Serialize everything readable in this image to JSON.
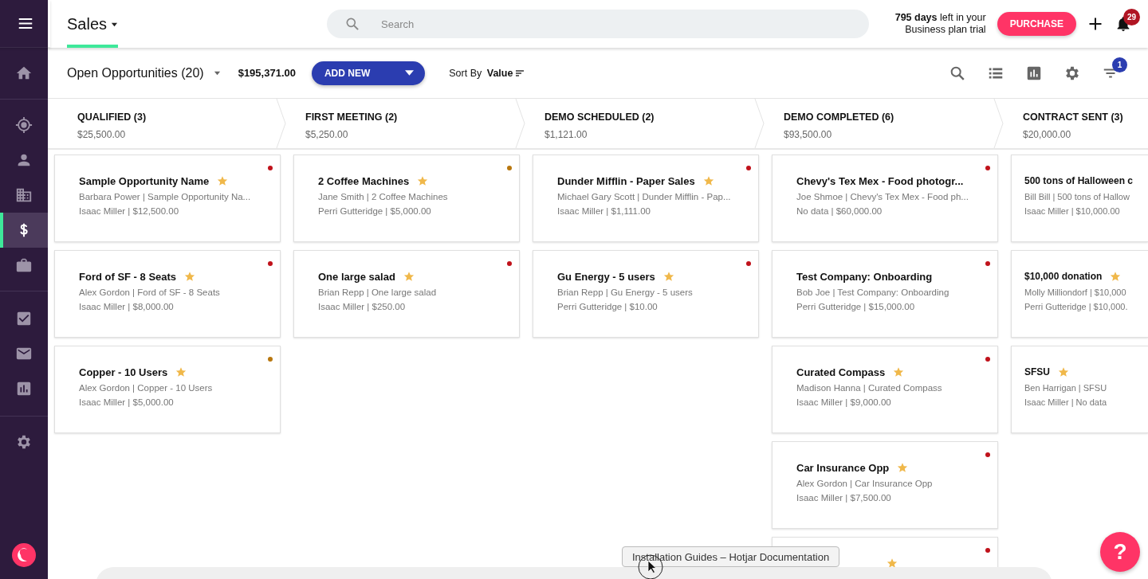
{
  "sidebar": {
    "items": [
      {
        "selected": false
      },
      {
        "selected": false
      },
      {
        "selected": false
      },
      {
        "selected": false
      },
      {
        "selected": true
      },
      {
        "selected": false
      },
      {
        "selected": false
      },
      {
        "selected": false
      },
      {
        "selected": false
      },
      {
        "selected": false
      }
    ]
  },
  "header": {
    "title": "Sales",
    "search": {
      "placeholder": "Search"
    },
    "trial": "**795 days** left in your Business plan trial",
    "purchase": "PURCHASE",
    "notifications": "29"
  },
  "toolbar": {
    "view": "Open Opportunities (20)",
    "total": "$195,371.00",
    "add": "ADD NEW",
    "sort_label": "Sort By",
    "sort_value": "Value",
    "filter_count": "1"
  },
  "stages": [
    {
      "name": "QUALIFIED (3)",
      "amount": "$25,500.00",
      "cards": [
        {
          "title": "Sample Opportunity Name",
          "starred": true,
          "line1": "Barbara Power | Sample Opportunity Na...",
          "line2": "Isaac Miller | $12,500.00",
          "color": "#c0121b"
        },
        {
          "title": "Ford of SF - 8 Seats",
          "starred": true,
          "line1": "Alex Gordon | Ford of SF - 8 Seats",
          "line2": "Isaac Miller | $8,000.00",
          "color": "#c0121b"
        },
        {
          "title": "Copper - 10 Users",
          "starred": true,
          "line1": "Alex Gordon | Copper - 10 Users",
          "line2": "Isaac Miller | $5,000.00",
          "color": "#b8770f"
        }
      ]
    },
    {
      "name": "FIRST MEETING (2)",
      "amount": "$5,250.00",
      "cards": [
        {
          "title": "2 Coffee Machines",
          "starred": true,
          "line1": "Jane Smith | 2 Coffee Machines",
          "line2": "Perri Gutteridge | $5,000.00",
          "color": "#b8770f"
        },
        {
          "title": "One large salad",
          "starred": true,
          "line1": "Brian Repp | One large salad",
          "line2": "Isaac Miller | $250.00",
          "color": "#c0121b"
        }
      ]
    },
    {
      "name": "DEMO SCHEDULED (2)",
      "amount": "$1,121.00",
      "cards": [
        {
          "title": "Dunder Mifflin - Paper Sales",
          "starred": true,
          "line1": "Michael Gary Scott | Dunder Mifflin - Pap...",
          "line2": "Isaac Miller | $1,111.00",
          "color": "#c0121b"
        },
        {
          "title": "Gu Energy - 5 users",
          "starred": true,
          "line1": "Brian Repp | Gu Energy - 5 users",
          "line2": "Perri Gutteridge | $10.00",
          "color": "#c0121b"
        }
      ]
    },
    {
      "name": "DEMO COMPLETED (6)",
      "amount": "$93,500.00",
      "cards": [
        {
          "title": "Chevy's Tex Mex - Food photogr...",
          "starred": false,
          "line1": "Joe Shmoe | Chevy's Tex Mex - Food ph...",
          "line2": "No data | $60,000.00",
          "color": "#c0121b"
        },
        {
          "title": "Test Company: Onboarding",
          "starred": false,
          "line1": "Bob Joe | Test Company: Onboarding",
          "line2": "Perri Gutteridge | $15,000.00",
          "color": "#c0121b"
        },
        {
          "title": "Curated Compass",
          "starred": true,
          "line1": "Madison Hanna | Curated Compass",
          "line2": "Isaac Miller | $9,000.00",
          "color": "#c0121b"
        },
        {
          "title": "Car Insurance Opp",
          "starred": true,
          "line1": "Alex Gordon | Car Insurance Opp",
          "line2": "Isaac Miller | $7,500.00",
          "color": "#c0121b"
        },
        {
          "starred": true,
          "color": "#c0121b"
        }
      ]
    },
    {
      "name": "CONTRACT SENT (3)",
      "amount": "$20,000.00",
      "cards": [
        {
          "title": "500 tons of Halloween c",
          "line1": "Bill Bill | 500 tons of Hallow",
          "line2": "Isaac Miller | $10,000.00"
        },
        {
          "title": "$10,000 donation",
          "starred": true,
          "line1": "Molly Milliondorf | $10,000",
          "line2": "Perri Gutteridge | $10,000."
        },
        {
          "title": "SFSU",
          "starred": true,
          "line1": "Ben Harrigan | SFSU",
          "line2": "Isaac Miller | No data"
        }
      ]
    }
  ],
  "tooltip": "Installation Guides – Hotjar Documentation",
  "help": "?"
}
